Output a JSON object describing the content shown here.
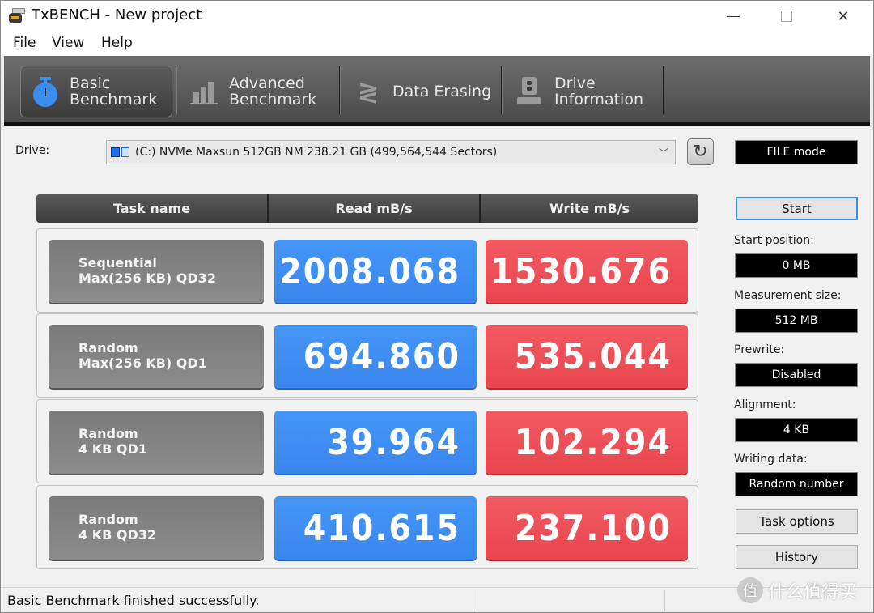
{
  "window": {
    "title": "TxBENCH - New project",
    "controls": {
      "minimize": "minimize",
      "maximize": "maximize",
      "close": "close"
    }
  },
  "menu": [
    "File",
    "View",
    "Help"
  ],
  "toolbar": {
    "tabs": [
      {
        "line1": "Basic",
        "line2": "Benchmark",
        "icon": "stopwatch-icon",
        "active": true
      },
      {
        "line1": "Advanced",
        "line2": "Benchmark",
        "icon": "bar-chart-icon",
        "active": false
      },
      {
        "line1": "Data Erasing",
        "line2": "",
        "icon": "eraser-icon",
        "active": false
      },
      {
        "line1": "Drive",
        "line2": "Information",
        "icon": "drive-info-icon",
        "active": false
      }
    ]
  },
  "drive": {
    "label": "Drive:",
    "selected": "(C:) NVMe Maxsun  512GB NM  238.21 GB (499,564,544 Sectors)",
    "mode": "FILE mode",
    "refresh_icon": "refresh-icon",
    "dropdown_icon": "chevron-down-icon"
  },
  "table": {
    "headers": [
      "Task name",
      "Read mB/s",
      "Write mB/s"
    ],
    "rows": [
      {
        "task_line1": "Sequential",
        "task_line2": "Max(256 KB) QD32",
        "read": "2008.068",
        "write": "1530.676"
      },
      {
        "task_line1": "Random",
        "task_line2": "Max(256 KB) QD1",
        "read": "694.860",
        "write": "535.044"
      },
      {
        "task_line1": "Random",
        "task_line2": "4 KB QD1",
        "read": "39.964",
        "write": "102.294"
      },
      {
        "task_line1": "Random",
        "task_line2": "4 KB QD32",
        "read": "410.615",
        "write": "237.100"
      }
    ]
  },
  "side_panel": {
    "start_label": "Start",
    "start_position": {
      "label": "Start position:",
      "value": "0 MB"
    },
    "measurement_size": {
      "label": "Measurement size:",
      "value": "512 MB"
    },
    "prewrite": {
      "label": "Prewrite:",
      "value": "Disabled"
    },
    "alignment": {
      "label": "Alignment:",
      "value": "4 KB"
    },
    "writing_data": {
      "label": "Writing data:",
      "value": "Random number"
    },
    "task_options_label": "Task options",
    "history_label": "History"
  },
  "status": {
    "message": "Basic Benchmark finished successfully."
  },
  "watermark": {
    "glyph": "值",
    "text": "什么值得买"
  },
  "colors": {
    "read": "#3a86ee",
    "write": "#e8464e",
    "accent": "#3a8ee0"
  }
}
